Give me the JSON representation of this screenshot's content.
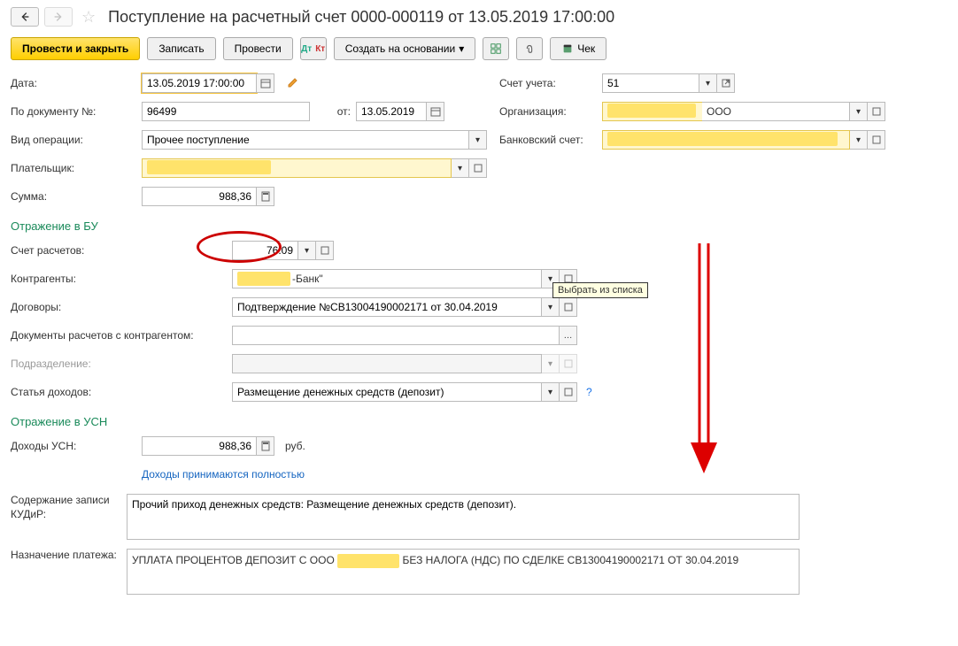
{
  "header": {
    "title": "Поступление на расчетный счет 0000-000119 от 13.05.2019 17:00:00"
  },
  "toolbar": {
    "post_close": "Провести и закрыть",
    "save": "Записать",
    "post": "Провести",
    "create_based": "Создать на основании",
    "receipt": "Чек"
  },
  "left": {
    "date_label": "Дата:",
    "date_value": "13.05.2019 17:00:00",
    "doc_num_label": "По документу №:",
    "doc_num_value": "96499",
    "doc_date_label": "от:",
    "doc_date_value": "13.05.2019",
    "op_type_label": "Вид операции:",
    "op_type_value": "Прочее поступление",
    "payer_label": "Плательщик:",
    "sum_label": "Сумма:",
    "sum_value": "988,36"
  },
  "right": {
    "account_label": "Счет учета:",
    "account_value": "51",
    "org_label": "Организация:",
    "org_suffix": "ООО",
    "bank_account_label": "Банковский счет:"
  },
  "bu": {
    "section": "Отражение в БУ",
    "acct_label": "Счет расчетов:",
    "acct_value": "76.09",
    "counterparty_label": "Контрагенты:",
    "counterparty_suffix": "-Банк\"",
    "contract_label": "Договоры:",
    "contract_value": "Подтверждение №СВ13004190002171 от 30.04.2019",
    "docs_label": "Документы расчетов с контрагентом:",
    "dept_label": "Подразделение:",
    "income_label": "Статья доходов:",
    "income_value": "Размещение денежных средств (депозит)",
    "tooltip": "Выбрать из списка"
  },
  "usn": {
    "section": "Отражение в УСН",
    "income_label": "Доходы УСН:",
    "income_value": "988,36",
    "currency": "руб.",
    "link": "Доходы принимаются полностью"
  },
  "kudir": {
    "label": "Содержание записи КУДиР:",
    "value": "Прочий приход денежных средств: Размещение денежных средств (депозит)."
  },
  "purpose": {
    "label": "Назначение платежа:",
    "value_before": "УПЛАТА ПРОЦЕНТОВ ДЕПОЗИТ С ООО ",
    "value_after": " БЕЗ НАЛОГА (НДС) ПО СДЕЛКЕ СВ13004190002171 ОТ 30.04.2019"
  }
}
